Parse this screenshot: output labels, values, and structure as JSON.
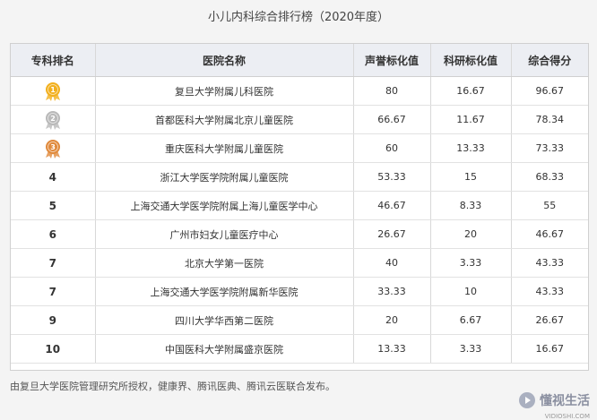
{
  "title": "小儿内科综合排行榜（2020年度）",
  "columns": [
    "专科排名",
    "医院名称",
    "声誉标化值",
    "科研标化值",
    "综合得分"
  ],
  "rows": [
    {
      "rank": "",
      "medal": "gold",
      "medal_num": "1",
      "hospital": "复旦大学附属儿科医院",
      "reputation": "80",
      "research": "16.67",
      "score": "96.67"
    },
    {
      "rank": "",
      "medal": "silver",
      "medal_num": "2",
      "hospital": "首都医科大学附属北京儿童医院",
      "reputation": "66.67",
      "research": "11.67",
      "score": "78.34"
    },
    {
      "rank": "",
      "medal": "bronze",
      "medal_num": "3",
      "hospital": "重庆医科大学附属儿童医院",
      "reputation": "60",
      "research": "13.33",
      "score": "73.33"
    },
    {
      "rank": "4",
      "hospital": "浙江大学医学院附属儿童医院",
      "reputation": "53.33",
      "research": "15",
      "score": "68.33"
    },
    {
      "rank": "5",
      "hospital": "上海交通大学医学院附属上海儿童医学中心",
      "reputation": "46.67",
      "research": "8.33",
      "score": "55"
    },
    {
      "rank": "6",
      "hospital": "广州市妇女儿童医疗中心",
      "reputation": "26.67",
      "research": "20",
      "score": "46.67"
    },
    {
      "rank": "7",
      "hospital": "北京大学第一医院",
      "reputation": "40",
      "research": "3.33",
      "score": "43.33"
    },
    {
      "rank": "7",
      "hospital": "上海交通大学医学院附属新华医院",
      "reputation": "33.33",
      "research": "10",
      "score": "43.33"
    },
    {
      "rank": "9",
      "hospital": "四川大学华西第二医院",
      "reputation": "20",
      "research": "6.67",
      "score": "26.67"
    },
    {
      "rank": "10",
      "hospital": "中国医科大学附属盛京医院",
      "reputation": "13.33",
      "research": "3.33",
      "score": "16.67"
    }
  ],
  "footer": "由复旦大学医院管理研究所授权，健康界、腾讯医典、腾讯云医联合发布。",
  "brand": {
    "name": "懂视生活",
    "sub": "VIDIOSHI.COM"
  },
  "colors": {
    "gold": "#f2b01e",
    "silver": "#b9b9b9",
    "bronze": "#e08a3c",
    "header_bg": "#eceef3"
  }
}
